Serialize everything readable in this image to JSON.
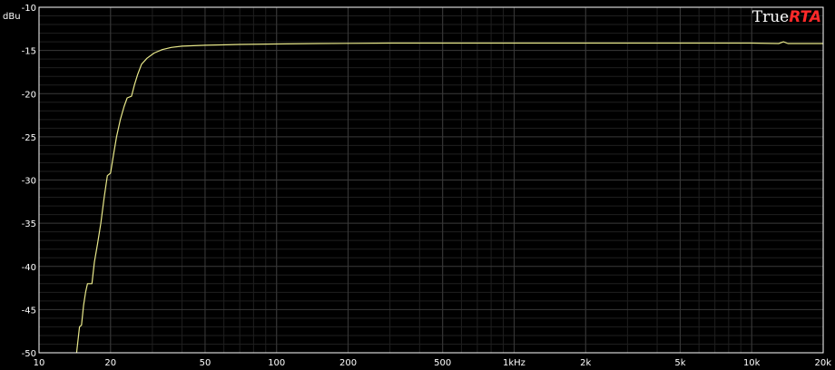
{
  "brand": {
    "prefix": "True",
    "suffix": "RTA"
  },
  "colors": {
    "background": "#000000",
    "grid_major": "#3a3a3a",
    "grid_minor": "#1f1f1f",
    "trace": "#e8e88a",
    "brand_accent": "#ff2a2a",
    "frame": "#ffffff"
  },
  "chart_data": {
    "type": "line",
    "title": "",
    "ylabel": "dBu",
    "xlabel": "",
    "xscale": "log",
    "xlim": [
      10,
      20000
    ],
    "ylim": [
      -50,
      -10
    ],
    "grid": true,
    "x_ticks": [
      {
        "value": 10,
        "label": "10"
      },
      {
        "value": 20,
        "label": "20"
      },
      {
        "value": 50,
        "label": "50"
      },
      {
        "value": 100,
        "label": "100"
      },
      {
        "value": 200,
        "label": "200"
      },
      {
        "value": 500,
        "label": "500"
      },
      {
        "value": 1000,
        "label": "1kHz"
      },
      {
        "value": 2000,
        "label": "2k"
      },
      {
        "value": 5000,
        "label": "5k"
      },
      {
        "value": 10000,
        "label": "10k"
      },
      {
        "value": 20000,
        "label": "20k"
      }
    ],
    "y_ticks": [
      {
        "value": -10,
        "label": "-10"
      },
      {
        "value": -15,
        "label": "-15"
      },
      {
        "value": -20,
        "label": "-20"
      },
      {
        "value": -25,
        "label": "-25"
      },
      {
        "value": -30,
        "label": "-30"
      },
      {
        "value": -35,
        "label": "-35"
      },
      {
        "value": -40,
        "label": "-40"
      },
      {
        "value": -45,
        "label": "-45"
      },
      {
        "value": -50,
        "label": "-50"
      }
    ],
    "series": [
      {
        "color": "#e8e88a",
        "points": [
          [
            14.4,
            -50
          ],
          [
            14.6,
            -48.5
          ],
          [
            14.8,
            -47
          ],
          [
            15.1,
            -46.8
          ],
          [
            15.4,
            -44.5
          ],
          [
            15.7,
            -43
          ],
          [
            16.0,
            -42
          ],
          [
            16.7,
            -42
          ],
          [
            17.1,
            -39.5
          ],
          [
            17.6,
            -37.5
          ],
          [
            18.2,
            -35
          ],
          [
            18.8,
            -32
          ],
          [
            19.4,
            -29.5
          ],
          [
            20.0,
            -29.2
          ],
          [
            20.6,
            -27
          ],
          [
            21.2,
            -25
          ],
          [
            22.0,
            -23
          ],
          [
            22.8,
            -21.5
          ],
          [
            23.5,
            -20.5
          ],
          [
            24.5,
            -20.3
          ],
          [
            25.2,
            -19
          ],
          [
            26.0,
            -17.8
          ],
          [
            27.0,
            -16.6
          ],
          [
            28.5,
            -15.9
          ],
          [
            30.5,
            -15.3
          ],
          [
            33.0,
            -14.9
          ],
          [
            36.0,
            -14.65
          ],
          [
            40.0,
            -14.5
          ],
          [
            50.0,
            -14.4
          ],
          [
            70.0,
            -14.3
          ],
          [
            100.0,
            -14.25
          ],
          [
            150.0,
            -14.2
          ],
          [
            300.0,
            -14.15
          ],
          [
            1000.0,
            -14.15
          ],
          [
            5000.0,
            -14.15
          ],
          [
            10000.0,
            -14.15
          ],
          [
            13000.0,
            -14.2
          ],
          [
            13600.0,
            -14.0
          ],
          [
            14200.0,
            -14.2
          ],
          [
            20000.0,
            -14.2
          ]
        ]
      }
    ]
  }
}
